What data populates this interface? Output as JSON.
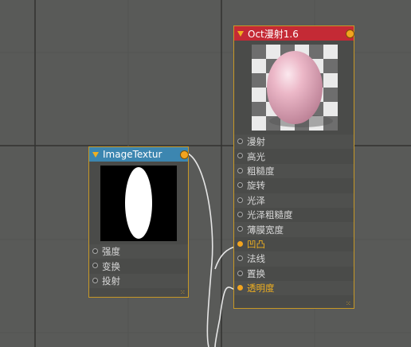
{
  "image_node": {
    "title": "ImageTextur",
    "header_color": "#3c86b0",
    "inputs": [
      {
        "label": "强度"
      },
      {
        "label": "变换"
      },
      {
        "label": "投射"
      }
    ]
  },
  "oct_node": {
    "title": "Oct漫射1.6",
    "header_color": "#c42a35",
    "inputs": [
      {
        "label": "漫射",
        "linked": false
      },
      {
        "label": "高光",
        "linked": false
      },
      {
        "label": "粗糙度",
        "linked": false
      },
      {
        "label": "旋转",
        "linked": false
      },
      {
        "label": "光泽",
        "linked": false
      },
      {
        "label": "光泽粗糙度",
        "linked": false
      },
      {
        "label": "薄膜宽度",
        "linked": false
      },
      {
        "label": "凹凸",
        "linked": true
      },
      {
        "label": "法线",
        "linked": false
      },
      {
        "label": "置换",
        "linked": false
      },
      {
        "label": "透明度",
        "linked": true
      }
    ]
  },
  "colors": {
    "canvas": "#595a58",
    "node_border": "#c79826",
    "wire": "#e6e6e6",
    "link_port": "#f2a41f"
  }
}
